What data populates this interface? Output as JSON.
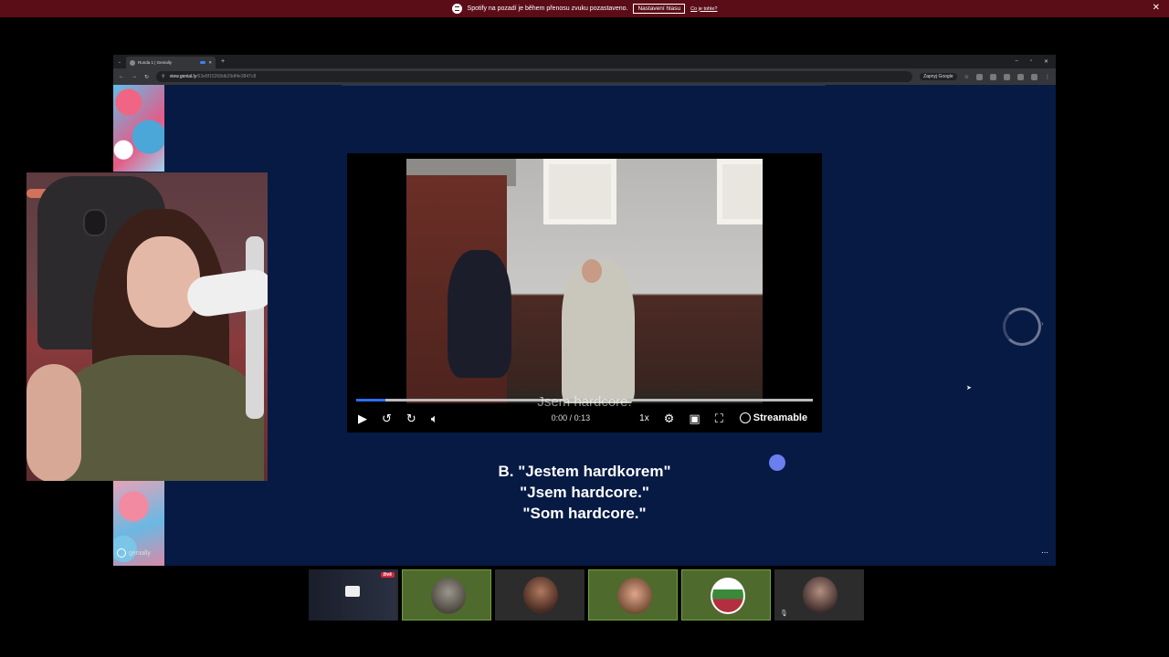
{
  "notification": {
    "message": "Spotify na pozadí je během přenosu zvuku pozastaveno.",
    "button": "Nastavení hlasu",
    "link": "Co je tohle?",
    "close": "✕"
  },
  "browser": {
    "tab_title": "Runda 1 | Genially",
    "url_host": "view.genial.ly",
    "url_path": "/63e8f15268db29df4e3847c8",
    "google_button": "Zapnyj Google"
  },
  "player": {
    "subtitle": "Jsem hardcore.",
    "time": "0:00 / 0:13",
    "speed": "1x",
    "brand": "Streamable",
    "progress_fraction": 0.064
  },
  "slide": {
    "answer_lines": [
      "B. \"Jestem hardkorem\"",
      "\"Jsem hardcore.\"",
      "\"Som hardcore.\""
    ],
    "brand": "genially"
  },
  "participants": {
    "live_badge": "živě"
  },
  "colors": {
    "notification_bg": "#5b0d17",
    "page_bg": "#061a44",
    "progress": "#2d6df6",
    "active_tile": "#4f6a2d"
  }
}
